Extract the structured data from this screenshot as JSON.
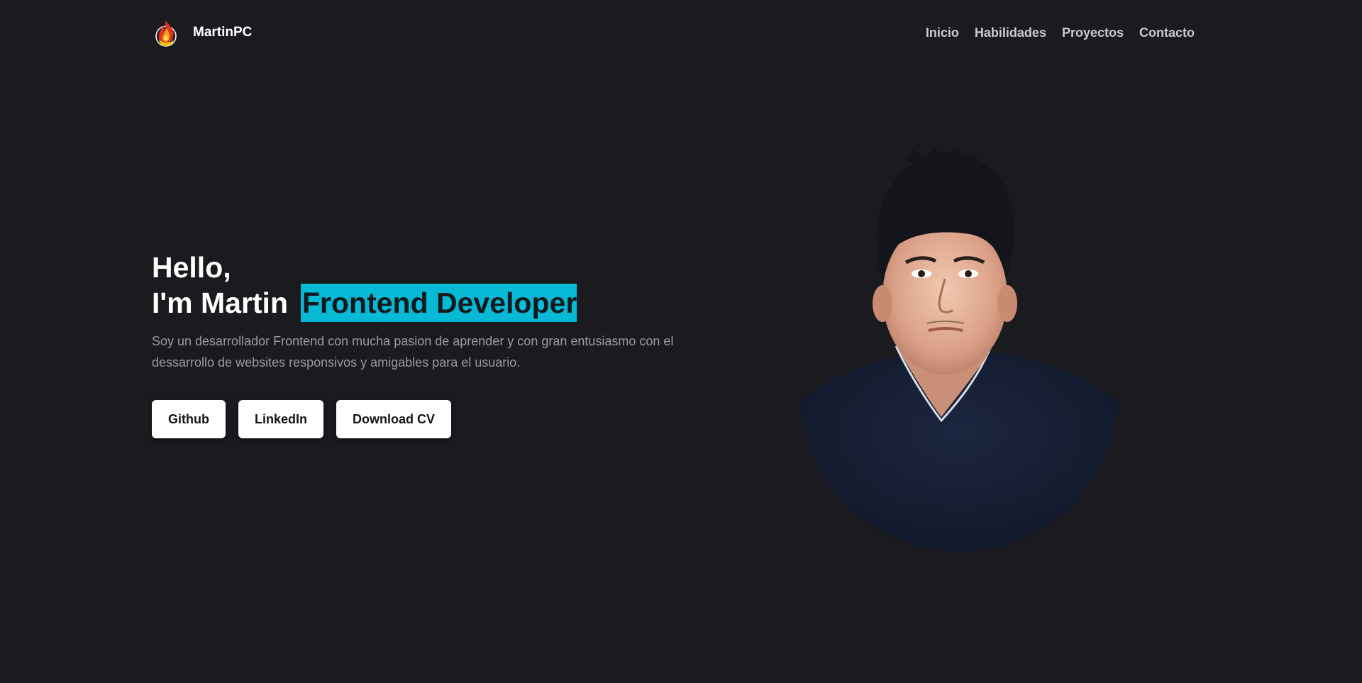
{
  "brand": {
    "name": "MartinPC",
    "logo_icon": "flame-logo-icon"
  },
  "nav": {
    "items": [
      "Inicio",
      "Habilidades",
      "Proyectos",
      "Contacto"
    ]
  },
  "hero": {
    "greeting": "Hello,",
    "intro": "I'm Martin",
    "role": "Frontend Developer",
    "description": "Soy un desarrollador Frontend con mucha pasion de aprender y con gran entusiasmo con el dessarrollo de websites responsivos y amigables para el usuario.",
    "buttons": [
      "Github",
      "LinkedIn",
      "Download CV"
    ]
  },
  "colors": {
    "background": "#1b1a1f",
    "accent": "#06bad5",
    "text": "#ffffff",
    "muted": "#9a9aa3"
  }
}
